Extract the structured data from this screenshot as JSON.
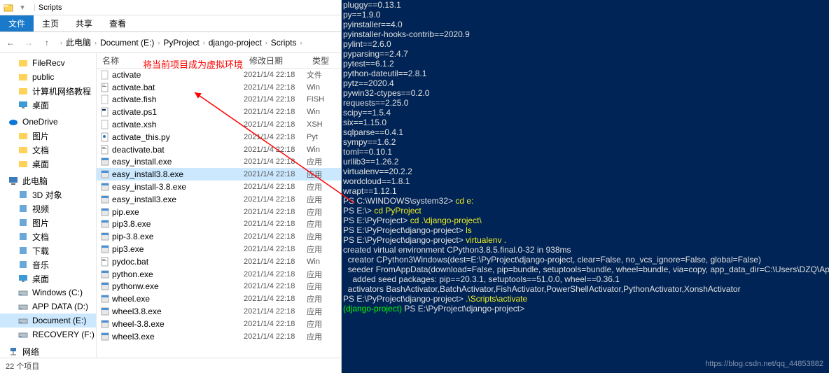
{
  "window": {
    "title": "Scripts",
    "sep": "|"
  },
  "ribbon": {
    "file": "文件",
    "home": "主页",
    "share": "共享",
    "view": "查看"
  },
  "breadcrumb": [
    "此电脑",
    "Document (E:)",
    "PyProject",
    "django-project",
    "Scripts"
  ],
  "columns": {
    "name": "名称",
    "date": "修改日期",
    "type": "类型"
  },
  "annotation": "将当前项目成为虚拟环境",
  "sidebar": {
    "quick": [
      {
        "label": "FileRecv",
        "icon": "folder"
      },
      {
        "label": "public",
        "icon": "folder"
      },
      {
        "label": "计算机网络教程",
        "icon": "folder"
      },
      {
        "label": "桌面",
        "icon": "desktop"
      }
    ],
    "onedrive": {
      "label": "OneDrive",
      "items": [
        {
          "label": "图片",
          "icon": "folder"
        },
        {
          "label": "文档",
          "icon": "folder"
        },
        {
          "label": "桌面",
          "icon": "folder"
        }
      ]
    },
    "thispc": {
      "label": "此电脑",
      "items": [
        {
          "label": "3D 对象",
          "icon": "3d"
        },
        {
          "label": "视频",
          "icon": "video"
        },
        {
          "label": "图片",
          "icon": "pictures"
        },
        {
          "label": "文档",
          "icon": "docs"
        },
        {
          "label": "下载",
          "icon": "downloads"
        },
        {
          "label": "音乐",
          "icon": "music"
        },
        {
          "label": "桌面",
          "icon": "desktop"
        },
        {
          "label": "Windows (C:)",
          "icon": "drive"
        },
        {
          "label": "APP DATA (D:)",
          "icon": "drive"
        },
        {
          "label": "Document (E:)",
          "icon": "drive",
          "sel": true
        },
        {
          "label": "RECOVERY (F:)",
          "icon": "drive"
        }
      ]
    },
    "network": {
      "label": "网络"
    }
  },
  "files": [
    {
      "name": "activate",
      "date": "2021/1/4 22:18",
      "type": "文件",
      "icon": "file"
    },
    {
      "name": "activate.bat",
      "date": "2021/1/4 22:18",
      "type": "Win",
      "icon": "bat"
    },
    {
      "name": "activate.fish",
      "date": "2021/1/4 22:18",
      "type": "FISH",
      "icon": "file"
    },
    {
      "name": "activate.ps1",
      "date": "2021/1/4 22:18",
      "type": "Win",
      "icon": "ps1"
    },
    {
      "name": "activate.xsh",
      "date": "2021/1/4 22:18",
      "type": "XSH",
      "icon": "file"
    },
    {
      "name": "activate_this.py",
      "date": "2021/1/4 22:18",
      "type": "Pyt",
      "icon": "py"
    },
    {
      "name": "deactivate.bat",
      "date": "2021/1/4 22:18",
      "type": "Win",
      "icon": "bat"
    },
    {
      "name": "easy_install.exe",
      "date": "2021/1/4 22:18",
      "type": "应用",
      "icon": "exe"
    },
    {
      "name": "easy_install3.8.exe",
      "date": "2021/1/4 22:18",
      "type": "应用",
      "icon": "exe",
      "sel": true
    },
    {
      "name": "easy_install-3.8.exe",
      "date": "2021/1/4 22:18",
      "type": "应用",
      "icon": "exe"
    },
    {
      "name": "easy_install3.exe",
      "date": "2021/1/4 22:18",
      "type": "应用",
      "icon": "exe"
    },
    {
      "name": "pip.exe",
      "date": "2021/1/4 22:18",
      "type": "应用",
      "icon": "exe"
    },
    {
      "name": "pip3.8.exe",
      "date": "2021/1/4 22:18",
      "type": "应用",
      "icon": "exe"
    },
    {
      "name": "pip-3.8.exe",
      "date": "2021/1/4 22:18",
      "type": "应用",
      "icon": "exe"
    },
    {
      "name": "pip3.exe",
      "date": "2021/1/4 22:18",
      "type": "应用",
      "icon": "exe"
    },
    {
      "name": "pydoc.bat",
      "date": "2021/1/4 22:18",
      "type": "Win",
      "icon": "bat"
    },
    {
      "name": "python.exe",
      "date": "2021/1/4 22:18",
      "type": "应用",
      "icon": "exe"
    },
    {
      "name": "pythonw.exe",
      "date": "2021/1/4 22:18",
      "type": "应用",
      "icon": "exe"
    },
    {
      "name": "wheel.exe",
      "date": "2021/1/4 22:18",
      "type": "应用",
      "icon": "exe"
    },
    {
      "name": "wheel3.8.exe",
      "date": "2021/1/4 22:18",
      "type": "应用",
      "icon": "exe"
    },
    {
      "name": "wheel-3.8.exe",
      "date": "2021/1/4 22:18",
      "type": "应用",
      "icon": "exe"
    },
    {
      "name": "wheel3.exe",
      "date": "2021/1/4 22:18",
      "type": "应用",
      "icon": "exe"
    }
  ],
  "status": "22 个项目",
  "terminal": {
    "lines": [
      {
        "t": "w",
        "s": "pluggy==0.13.1"
      },
      {
        "t": "w",
        "s": "py==1.9.0"
      },
      {
        "t": "w",
        "s": "pyinstaller==4.0"
      },
      {
        "t": "w",
        "s": "pyinstaller-hooks-contrib==2020.9"
      },
      {
        "t": "w",
        "s": "pylint==2.6.0"
      },
      {
        "t": "w",
        "s": "pyparsing==2.4.7"
      },
      {
        "t": "w",
        "s": "pytest==6.1.2"
      },
      {
        "t": "w",
        "s": "python-dateutil==2.8.1"
      },
      {
        "t": "w",
        "s": "pytz==2020.4"
      },
      {
        "t": "w",
        "s": "pywin32-ctypes==0.2.0"
      },
      {
        "t": "w",
        "s": "requests==2.25.0"
      },
      {
        "t": "w",
        "s": "scipy==1.5.4"
      },
      {
        "t": "w",
        "s": "six==1.15.0"
      },
      {
        "t": "w",
        "s": "sqlparse==0.4.1"
      },
      {
        "t": "w",
        "s": "sympy==1.6.2"
      },
      {
        "t": "w",
        "s": "toml==0.10.1"
      },
      {
        "t": "w",
        "s": "urllib3==1.26.2"
      },
      {
        "t": "w",
        "s": "virtualenv==20.2.2"
      },
      {
        "t": "w",
        "s": "wordcloud==1.8.1"
      },
      {
        "t": "w",
        "s": "wrapt==1.12.1"
      },
      {
        "t": "p",
        "s": "PS C:\\WINDOWS\\system32> ",
        "c": "cd e:"
      },
      {
        "t": "p",
        "s": "PS E:\\> ",
        "c": "cd PyProject"
      },
      {
        "t": "p",
        "s": "PS E:\\PyProject> ",
        "c": "cd .\\django-project\\"
      },
      {
        "t": "p",
        "s": "PS E:\\PyProject\\django-project> ",
        "c": "ls"
      },
      {
        "t": "p",
        "s": "PS E:\\PyProject\\django-project> ",
        "c": "virtualenv ."
      },
      {
        "t": "w",
        "s": "created virtual environment CPython3.8.5.final.0-32 in 938ms"
      },
      {
        "t": "w",
        "s": "  creator CPython3Windows(dest=E:\\PyProject\\django-project, clear=False, no_vcs_ignore=False, global=False)"
      },
      {
        "t": "w",
        "s": "  seeder FromAppData(download=False, pip=bundle, setuptools=bundle, wheel=bundle, via=copy, app_data_dir=C:\\Users\\DZQ\\AppData\\Local\\pypa\\virtualenv)"
      },
      {
        "t": "w",
        "s": "    added seed packages: pip==20.3.1, setuptools==51.0.0, wheel==0.36.1"
      },
      {
        "t": "w",
        "s": "  activators BashActivator,BatchActivator,FishActivator,PowerShellActivator,PythonActivator,XonshActivator"
      },
      {
        "t": "p",
        "s": "PS E:\\PyProject\\django-project> ",
        "c": ".\\Scripts\\activate"
      },
      {
        "t": "g",
        "s": "(django-project) PS E:\\PyProject\\django-project>"
      }
    ]
  },
  "watermark": "https://blog.csdn.net/qq_44853882"
}
